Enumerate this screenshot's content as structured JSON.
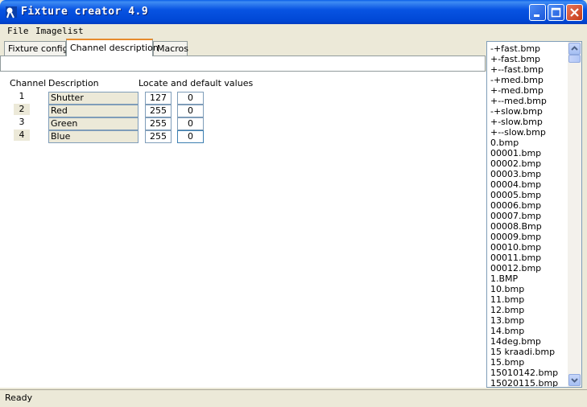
{
  "window": {
    "title": "Fixture creator 4.9"
  },
  "menu": {
    "file": "File",
    "imagelist": "Imagelist"
  },
  "tabs": [
    {
      "label": "Fixture config."
    },
    {
      "label": "Channel description"
    },
    {
      "label": "Macros"
    }
  ],
  "headers": {
    "channel": "Channel",
    "description": "Description",
    "values": "Locate and default values"
  },
  "channels": [
    {
      "num": "1",
      "desc": "Shutter",
      "locate": "127",
      "default": "0"
    },
    {
      "num": "2",
      "desc": "Red",
      "locate": "255",
      "default": "0"
    },
    {
      "num": "3",
      "desc": "Green",
      "locate": "255",
      "default": "0"
    },
    {
      "num": "4",
      "desc": "Blue",
      "locate": "255",
      "default": "0"
    }
  ],
  "images": [
    "-+fast.bmp",
    "+-fast.bmp",
    "+--fast.bmp",
    "-+med.bmp",
    "+-med.bmp",
    "+--med.bmp",
    "-+slow.bmp",
    "+-slow.bmp",
    "+--slow.bmp",
    "0.bmp",
    "00001.bmp",
    "00002.bmp",
    "00003.bmp",
    "00004.bmp",
    "00005.bmp",
    "00006.bmp",
    "00007.bmp",
    "00008.Bmp",
    "00009.bmp",
    "00010.bmp",
    "00011.bmp",
    "00012.bmp",
    "1.BMP",
    "10.bmp",
    "11.bmp",
    "12.bmp",
    "13.bmp",
    "14.bmp",
    "14deg.bmp",
    "15 kraadi.bmp",
    "15.bmp",
    "15010142.bmp",
    "15020115.bmp"
  ],
  "status": {
    "text": "Ready"
  }
}
